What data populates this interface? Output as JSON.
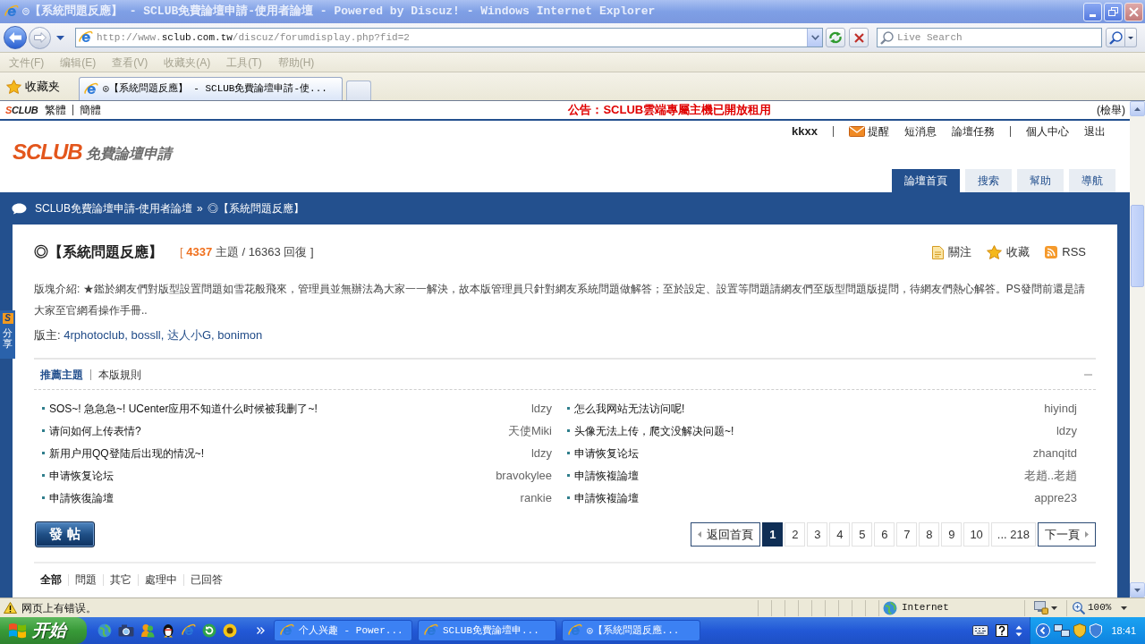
{
  "window": {
    "title": "◎【系統問題反應】 - SCLUB免費論壇申請-使用者論壇 - Powered by Discuz! - Windows Internet Explorer"
  },
  "address_bar": {
    "url": {
      "scheme": "http://www.",
      "domain": "sclub.com.tw",
      "path": "/discuz/forumdisplay.php?fid=2"
    },
    "search": {
      "placeholder": "Live Search"
    }
  },
  "menu_bar": [
    {
      "label": "文件(F)",
      "disabled": true
    },
    {
      "label": "编辑(E)",
      "disabled": true
    },
    {
      "label": "查看(V)",
      "disabled": true
    },
    {
      "label": "收藏夹(A)",
      "disabled": true
    },
    {
      "label": "工具(T)",
      "disabled": true
    },
    {
      "label": "帮助(H)",
      "disabled": true
    }
  ],
  "favorites": {
    "label": "收藏夹"
  },
  "tabs": [
    {
      "label": "◎【系統問題反應】 - SCLUB免費論壇申請-使...",
      "selected": true
    }
  ],
  "page": {
    "top_bar": {
      "logo": "SCLUB",
      "languages": [
        {
          "label": "繁體"
        },
        {
          "label": "簡體"
        }
      ],
      "announcement": "公告：SCLUB雲端專屬主機已開放租用",
      "report": "(檢舉)"
    },
    "logo": {
      "mark": "SCLUB",
      "tagline": "免費論壇申請"
    },
    "user_menu": {
      "username": "kkxx",
      "groups": [
        [
          {
            "label": "提醒",
            "kind": "alert"
          },
          {
            "label": "短消息",
            "kind": "plain"
          },
          {
            "label": "論壇任務",
            "kind": "plain"
          }
        ],
        [
          {
            "label": "個人中心",
            "kind": "plain"
          },
          {
            "label": "退出",
            "kind": "plain"
          }
        ]
      ]
    },
    "nav": [
      {
        "label": "論壇首頁",
        "selected": true
      },
      {
        "label": "搜索",
        "selected": false
      },
      {
        "label": "幫助",
        "selected": false
      },
      {
        "label": "導航",
        "selected": false
      }
    ],
    "breadcrumb": {
      "items": [
        "SCLUB免費論壇申請-使用者論壇",
        "◎【系統問題反應】"
      ],
      "separator": "»"
    },
    "forum": {
      "title": "◎【系統問題反應】",
      "stats": {
        "open": "[",
        "topics": "4337",
        "rest": "主題 / 16363 回復",
        "close": "]"
      },
      "actions": [
        {
          "label": "關注",
          "kind": "follow"
        },
        {
          "label": "收藏",
          "kind": "favorite"
        },
        {
          "label": "RSS",
          "kind": "rss"
        }
      ],
      "description": "版塊介紹: ★鑑於網友們對版型設置問題如雪花般飛來，管理員並無辦法為大家一一解決，故本版管理員只針對網友系統問題做解答；至於設定、設置等問題請網友們至版型問題版提問，待網友們熱心解答。PS發問前還是請大家至官網看操作手冊..",
      "moderators": {
        "label": "版主:",
        "names": [
          "4rphotoclub",
          "bossll",
          "达人小G",
          "bonimon"
        ],
        "separator": ","
      }
    },
    "featured": {
      "tabs": [
        {
          "label": "推薦主題",
          "selected": true
        },
        {
          "label": "本版規則",
          "selected": false
        }
      ],
      "topics": [
        {
          "title": "SOS~! 急急急~! UCenter应用不知道什么时候被我删了~!",
          "author": "ldzy"
        },
        {
          "title": "怎么我网站无法访问呢!",
          "author": "hiyindj"
        },
        {
          "title": "请问如何上传表情?",
          "author": "天使Miki"
        },
        {
          "title": "头像无法上传，爬文没解决问题~!",
          "author": "ldzy"
        },
        {
          "title": "新用户用QQ登陆后出现的情况~!",
          "author": "ldzy"
        },
        {
          "title": "申请恢复论坛",
          "author": "zhanqitd"
        },
        {
          "title": "申请恢复论坛",
          "author": "bravokylee"
        },
        {
          "title": "申請恢複論壇",
          "author": "老趙..老趙"
        },
        {
          "title": "申請恢復論壇",
          "author": "rankie"
        },
        {
          "title": "申請恢複論壇",
          "author": "appre23"
        }
      ]
    },
    "post_button": "發 帖",
    "pagination": {
      "prev": "返回首頁",
      "pages": [
        {
          "label": "1",
          "selected": true
        },
        {
          "label": "2",
          "selected": false
        },
        {
          "label": "3",
          "selected": false
        },
        {
          "label": "4",
          "selected": false
        },
        {
          "label": "5",
          "selected": false
        },
        {
          "label": "6",
          "selected": false
        },
        {
          "label": "7",
          "selected": false
        },
        {
          "label": "8",
          "selected": false
        },
        {
          "label": "9",
          "selected": false
        },
        {
          "label": "10",
          "selected": false
        },
        {
          "label": "... 218",
          "selected": false
        }
      ],
      "next": "下一頁"
    },
    "filters": [
      {
        "label": "全部",
        "selected": true
      },
      {
        "label": "問題",
        "selected": false
      },
      {
        "label": "其它",
        "selected": false
      },
      {
        "label": "處理中",
        "selected": false
      },
      {
        "label": "已回答",
        "selected": false
      }
    ],
    "share": {
      "badge": "S",
      "label": "分享"
    }
  },
  "status_bar": {
    "message": "网页上有错误。",
    "zone": "Internet",
    "zoom": "100%"
  },
  "taskbar": {
    "start": "开始",
    "buttons": [
      {
        "label": "个人兴趣 - Power...",
        "selected": false
      },
      {
        "label": "SCLUB免費論壇申...",
        "selected": false
      },
      {
        "label": "◎【系統問題反應...",
        "selected": false
      }
    ],
    "clock": "18:41"
  }
}
